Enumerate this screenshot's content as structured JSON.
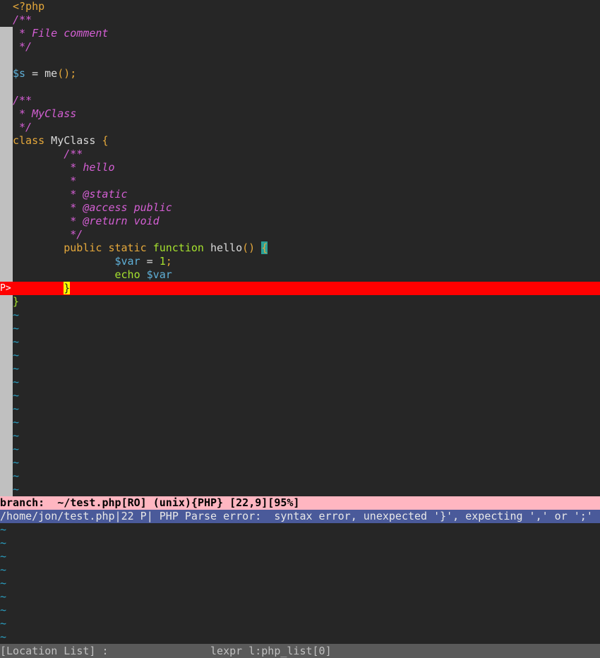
{
  "editor": {
    "lines": {
      "l1": "<?php",
      "l2": "/**",
      "l3": " * File comment",
      "l4": " */",
      "l6_var": "$s",
      "l6_op": " = ",
      "l6_fn": "me",
      "l6_paren": "();",
      "l8": "/**",
      "l9": " * MyClass",
      "l10": " */",
      "l11_kw": "class",
      "l11_name": " MyClass ",
      "l11_brace": "{",
      "l12": "        /**",
      "l13": "         * hello",
      "l14": "         *",
      "l15": "         * @static",
      "l16": "         * @access public",
      "l17": "         * @return void",
      "l18": "         */",
      "l19_indent": "        ",
      "l19_kw": "public static ",
      "l19_func": "function",
      "l19_name": " hello",
      "l19_paren": "() ",
      "l19_brace": "{",
      "l20_indent": "                ",
      "l20_var": "$var",
      "l20_op": " = ",
      "l20_num": "1",
      "l20_semi": ";",
      "l21_indent": "                ",
      "l21_echo": "echo ",
      "l21_var": "$var",
      "l22_indent": "        ",
      "l22_brace": "}",
      "l23_brace": "}"
    },
    "error_sign": "P>",
    "tilde": "~"
  },
  "statusbar": {
    "text": "branch:  ~/test.php[RO] (unix){PHP} [22,9][95%]"
  },
  "location_list": {
    "entry": "/home/jon/test.php|22 P| PHP Parse error:  syntax error, unexpected '}', expecting ',' or ';'",
    "status": "[Location List] :                lexpr l:php_list[0]"
  },
  "colors": {
    "background": "#262626",
    "error_line": "#ff0000",
    "statusbar": "#ffb6c1",
    "loclist": "#4a5a9a"
  }
}
